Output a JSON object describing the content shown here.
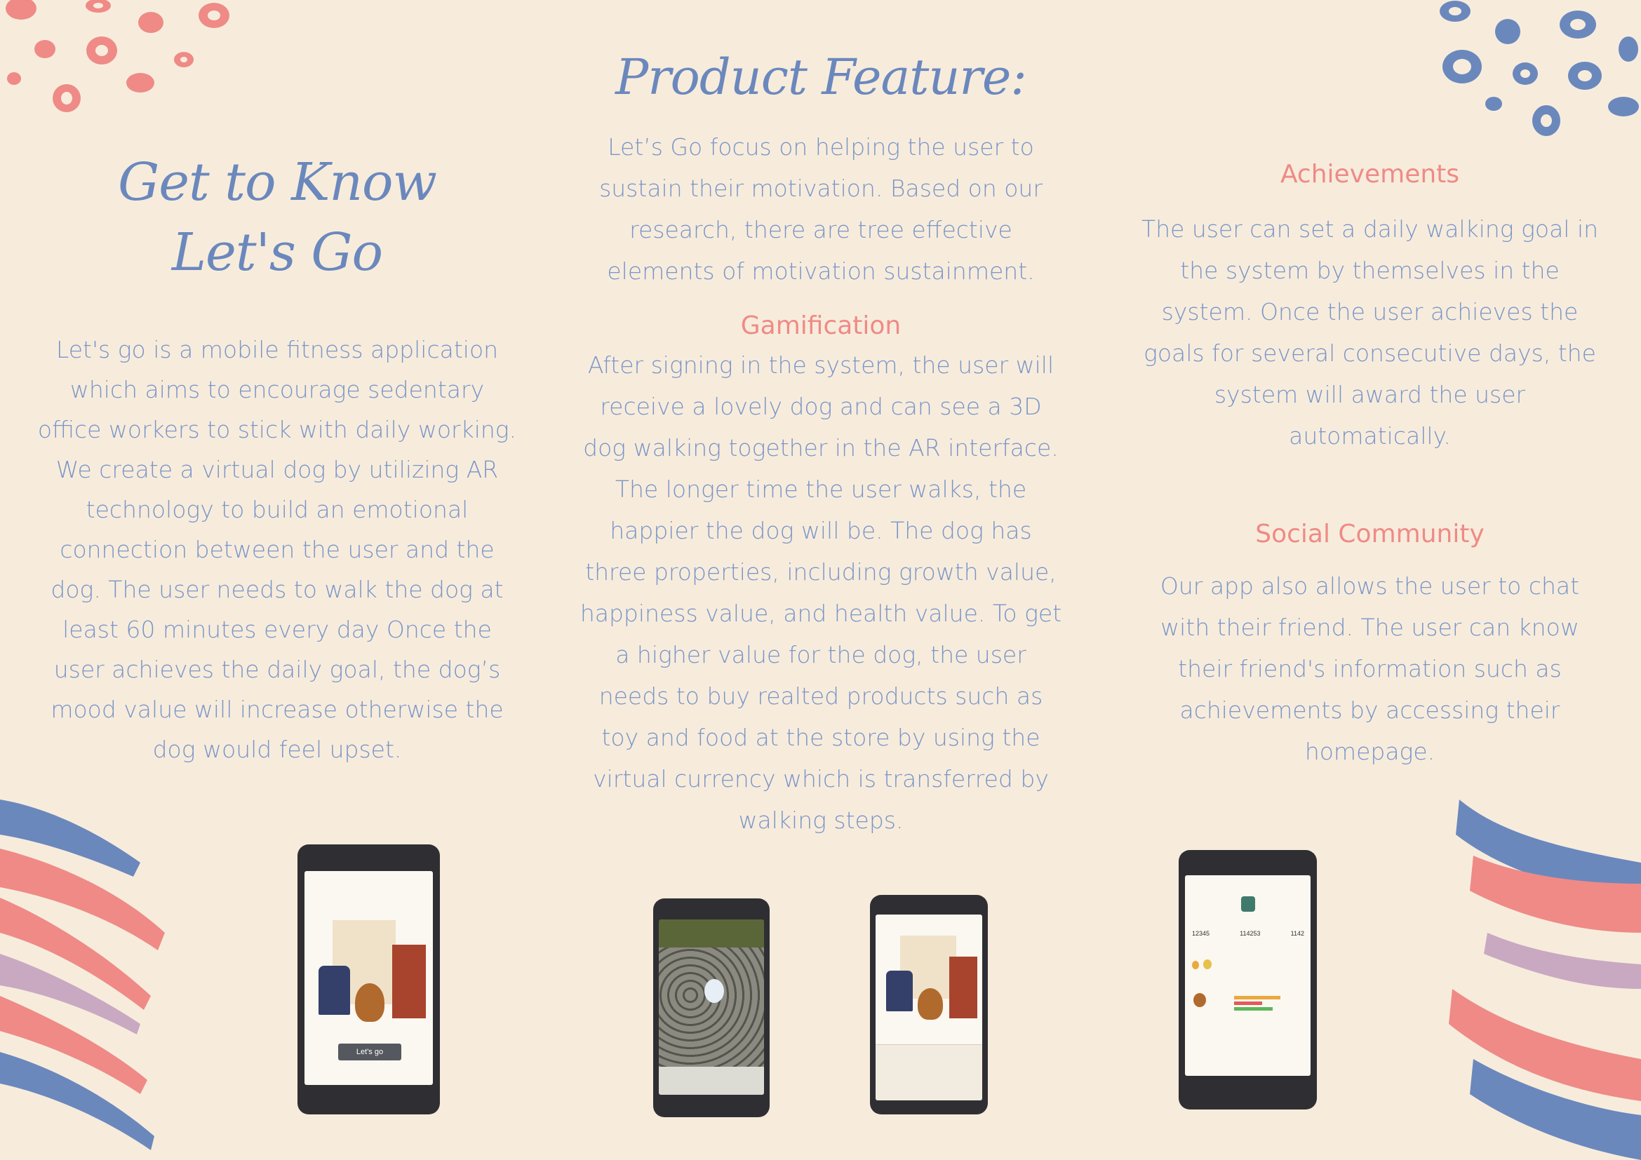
{
  "colors": {
    "background": "#f7ecdc",
    "blue": "#6b88bd",
    "pink": "#ef8a86",
    "phone": "#2f2f33"
  },
  "left": {
    "title_line1": "Get to Know",
    "title_line2": "Let's Go",
    "paragraph": "Let's go is a mobile fitness application which aims to encourage sedentary office workers to stick with daily working. We create a virtual dog by utilizing AR technology to build an emotional connection between the user and the dog. The user needs to walk the dog at least 60 minutes every day Once the user achieves the daily goal, the dog’s mood value will increase otherwise the dog would feel upset.",
    "phone_button": "Let's go"
  },
  "center": {
    "title": "Product Feature:",
    "intro": "Let’s Go focus on helping the user to sustain their motivation. Based on our research, there are tree effective elements of motivation sustainment.",
    "gamification_heading": "Gamification",
    "gamification_text": "After signing in the system, the user will receive a lovely dog and can see a 3D dog walking together in the AR interface. The longer time the user walks, the happier the dog will be. The dog has three properties, including growth value, happiness value, and health value. To get a higher value for the dog, the user needs to buy realted products such as toy and food at the store by using the virtual currency which is transferred by walking steps."
  },
  "right": {
    "achievements_heading": "Achievements",
    "achievements_text": "The user can set a daily walking goal in the system by themselves in the system. Once the user achieves the goals for several consecutive days, the system will award the user automatically.",
    "social_heading": "Social Community",
    "social_text": "Our app also allows the user to chat with their friend. The user can know their friend's information such as achievements by accessing their homepage.",
    "profile_stats": [
      "12345",
      "114253",
      "1142"
    ]
  },
  "icons": {
    "dots_top_left": "pink-dots-decoration",
    "dots_top_right": "blue-dots-decoration",
    "brush_left": "brush-stroke-decoration",
    "brush_right": "brush-stroke-decoration"
  }
}
